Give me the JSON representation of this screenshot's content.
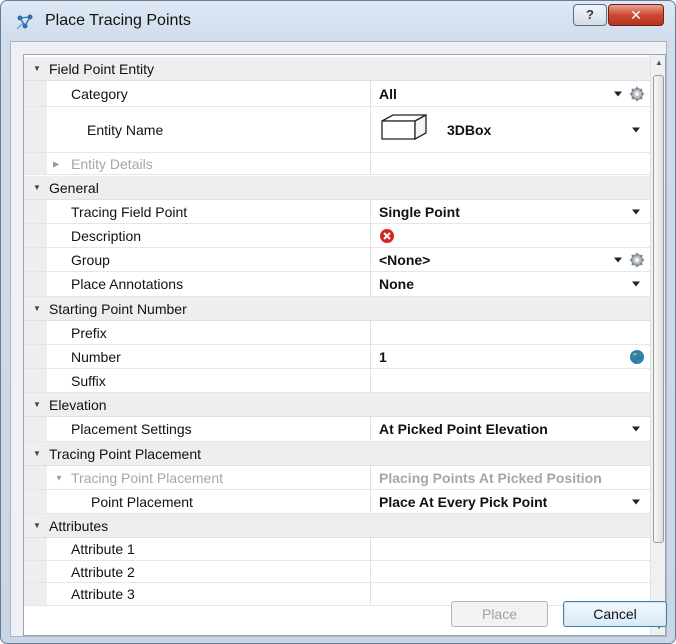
{
  "window": {
    "title": "Place Tracing Points",
    "help_label": "?",
    "close_label": "✕"
  },
  "sections": {
    "field_point_entity": "Field Point Entity",
    "general": "General",
    "starting_point_number": "Starting Point Number",
    "elevation": "Elevation",
    "tracing_point_placement": "Tracing Point Placement",
    "attributes": "Attributes"
  },
  "props": {
    "category": {
      "label": "Category",
      "value": "All"
    },
    "entity_name": {
      "label": "Entity Name",
      "value": "3DBox"
    },
    "entity_details": {
      "label": "Entity Details"
    },
    "tracing_field_point": {
      "label": "Tracing Field Point",
      "value": "Single Point"
    },
    "description": {
      "label": "Description"
    },
    "group": {
      "label": "Group",
      "value": "<None>"
    },
    "place_annotations": {
      "label": "Place Annotations",
      "value": "None"
    },
    "prefix": {
      "label": "Prefix",
      "value": ""
    },
    "number": {
      "label": "Number",
      "value": "1"
    },
    "suffix": {
      "label": "Suffix",
      "value": ""
    },
    "placement_settings": {
      "label": "Placement Settings",
      "value": "At Picked Point Elevation"
    },
    "tracing_point_placement_sub": {
      "label": "Tracing Point Placement",
      "value": "Placing Points At Picked Position"
    },
    "point_placement": {
      "label": "Point Placement",
      "value": "Place At Every Pick Point"
    },
    "attribute_1": {
      "label": "Attribute 1",
      "value": ""
    },
    "attribute_2": {
      "label": "Attribute 2",
      "value": ""
    },
    "attribute_3": {
      "label": "Attribute 3",
      "value": ""
    }
  },
  "buttons": {
    "place": "Place",
    "cancel": "Cancel"
  },
  "colors": {
    "accent": "#3c7fb1",
    "error": "#d0261d",
    "category_bg": "#eeeeee"
  },
  "icons": {
    "app": "tracing-points-icon",
    "gear": "gear-icon",
    "error": "error-icon",
    "globe": "globe-icon",
    "box": "3d-box-icon"
  }
}
